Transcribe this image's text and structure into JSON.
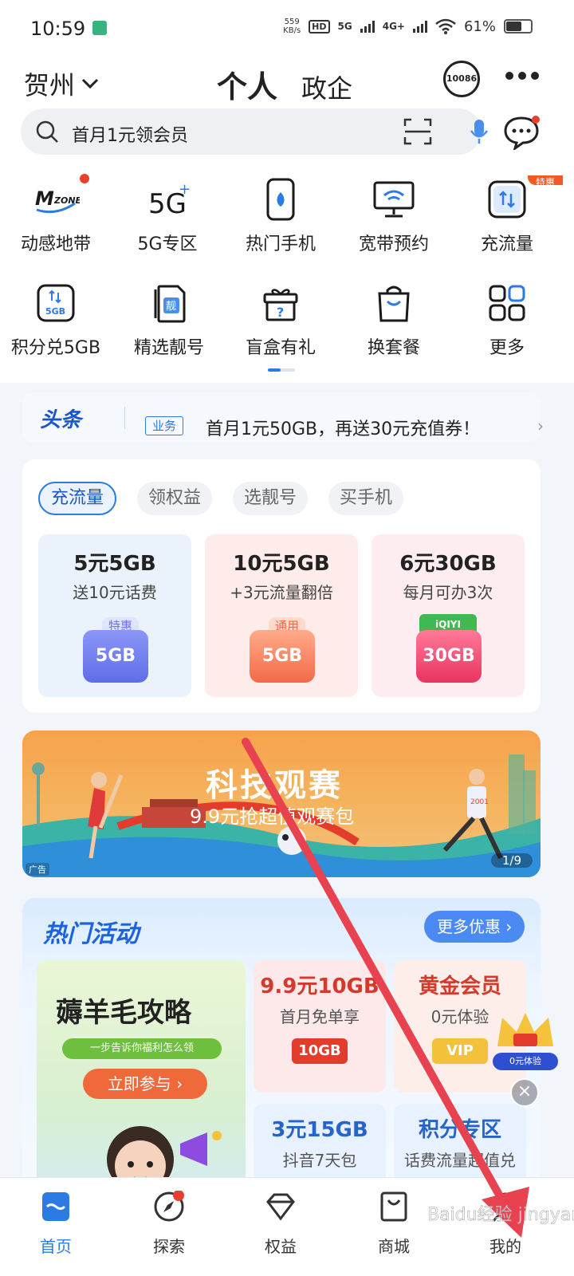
{
  "status_bar": {
    "time": "10:59",
    "net_speed_value": "559",
    "net_speed_unit": "KB/s",
    "hd": "HD",
    "net1": "5G",
    "net2": "4G+",
    "battery": "61%"
  },
  "header": {
    "city": "贺州",
    "tab_personal": "个人",
    "tab_enterprise": "政企",
    "hotline": "10086",
    "search_placeholder": "首月1元领会员"
  },
  "quick_menu": [
    {
      "label": "动感地带",
      "icon": "mzone-icon"
    },
    {
      "label": "5G专区",
      "icon": "5g-icon"
    },
    {
      "label": "热门手机",
      "icon": "phone-icon"
    },
    {
      "label": "宽带预约",
      "icon": "broadband-icon"
    },
    {
      "label": "充流量",
      "icon": "data-recharge-icon"
    },
    {
      "label": "积分兑5GB",
      "icon": "points-5gb-icon"
    },
    {
      "label": "精选靓号",
      "icon": "sim-icon"
    },
    {
      "label": "盲盒有礼",
      "icon": "gift-box-icon"
    },
    {
      "label": "换套餐",
      "icon": "shopping-bag-icon"
    },
    {
      "label": "更多",
      "icon": "more-grid-icon"
    }
  ],
  "special_badge": "特惠",
  "headline": {
    "title": "头条",
    "tag": "业务",
    "text": "首月1元50GB，再送30元充值券！"
  },
  "recharge_card": {
    "pills": [
      "充流量",
      "领权益",
      "选靓号",
      "买手机"
    ],
    "offers": [
      {
        "title": "5元5GB",
        "subtitle": "送10元话费",
        "badge": "特惠",
        "icon_text": "5GB"
      },
      {
        "title": "10元5GB",
        "subtitle": "+3元流量翻倍",
        "badge": "通用",
        "icon_text": "5GB"
      },
      {
        "title": "6元30GB",
        "subtitle": "每月可办3次",
        "badge": "iQIYI",
        "icon_text": "30GB"
      }
    ]
  },
  "banner": {
    "title": "科技观赛",
    "subtitle": "9.9元抢超值观赛包",
    "ad": "广告",
    "page": "1/9",
    "bib": "2001"
  },
  "hot_activities": {
    "title": "热门活动",
    "more": "更多优惠 ›",
    "promo": {
      "title": "薅羊毛攻略",
      "subtitle": "一步告诉你福利怎么领",
      "cta": "立即参与 ›"
    },
    "tiles": [
      {
        "title": "9.9元10GB",
        "subtitle": "首月免单享",
        "badge": "10GB"
      },
      {
        "title": "黄金会员",
        "subtitle": "0元体验",
        "badge": "VIP"
      },
      {
        "title": "3元15GB",
        "subtitle": "抖音7天包"
      },
      {
        "title": "积分专区",
        "subtitle": "话费流量超值兑"
      }
    ]
  },
  "floating_gift": {
    "label": "0元体验"
  },
  "bottom_nav": [
    {
      "label": "首页",
      "icon": "home-icon"
    },
    {
      "label": "探索",
      "icon": "compass-icon"
    },
    {
      "label": "权益",
      "icon": "diamond-icon"
    },
    {
      "label": "商城",
      "icon": "store-bag-icon"
    },
    {
      "label": "我的",
      "icon": "profile-icon"
    }
  ],
  "watermark": "Baidu经验 jingyan.baidu.com",
  "colors": {
    "accent": "#2c7be5",
    "red": "#e8402c",
    "arrow": "#e8414f"
  }
}
